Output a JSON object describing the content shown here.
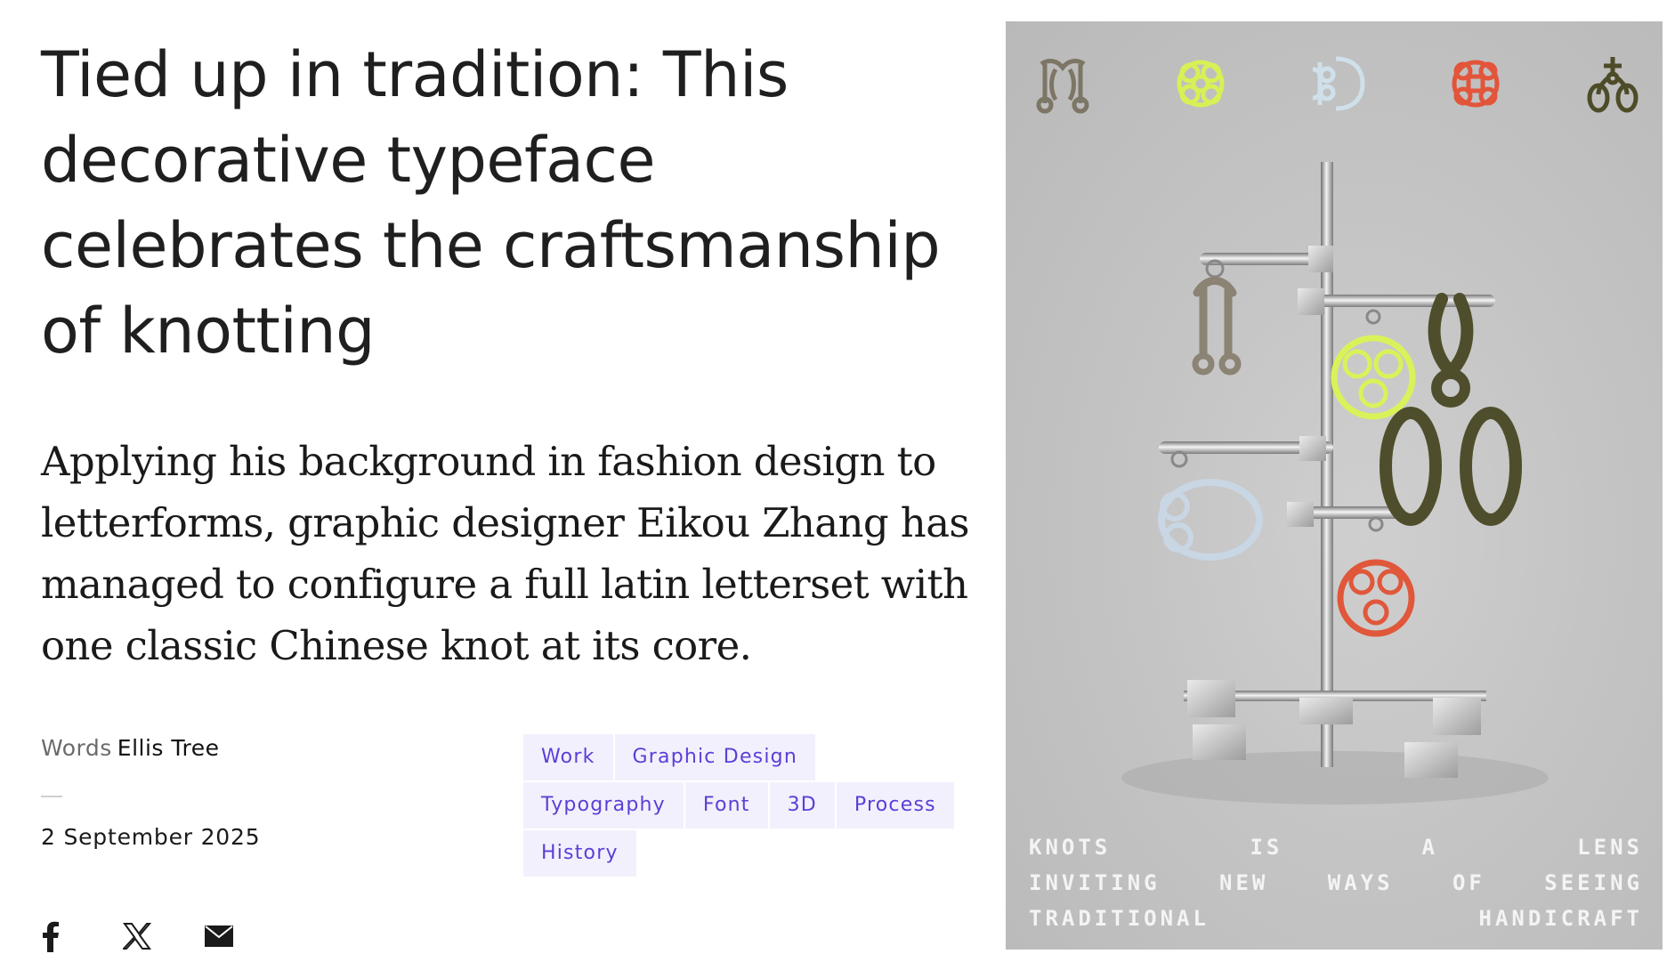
{
  "article": {
    "headline": "Tied up in tradition: This decorative typeface celebrates the craftsmanship of knotting",
    "standfirst": "Applying his background in fashion design to letterforms, graphic designer Eikou Zhang has managed to configure a full latin letterset with one classic Chinese knot at its core.",
    "byline_label": "Words",
    "author": "Ellis Tree",
    "date": "2 September 2025"
  },
  "tags": [
    {
      "label": "Work"
    },
    {
      "label": "Graphic Design"
    },
    {
      "label": "Typography"
    },
    {
      "label": "Font"
    },
    {
      "label": "3D"
    },
    {
      "label": "Process"
    },
    {
      "label": "History"
    }
  ],
  "share": [
    {
      "name": "facebook-icon"
    },
    {
      "name": "x-icon"
    },
    {
      "name": "mail-icon"
    }
  ],
  "poster": {
    "lines": [
      [
        "Knots",
        "is",
        "a",
        "lens"
      ],
      [
        "inviting",
        "new",
        "ways",
        "of",
        "seeing"
      ],
      [
        "traditional",
        "handicraft"
      ]
    ],
    "colors": {
      "background": "#c4c4c4",
      "knot_beige": "#8a8272",
      "knot_lime": "#d9f25a",
      "knot_blue": "#c9d8e6",
      "knot_red": "#e0573a",
      "knot_olive": "#4f4e2c"
    }
  },
  "theme": {
    "tag_bg": "#f3f0fd",
    "tag_text": "#5b3fd6"
  }
}
